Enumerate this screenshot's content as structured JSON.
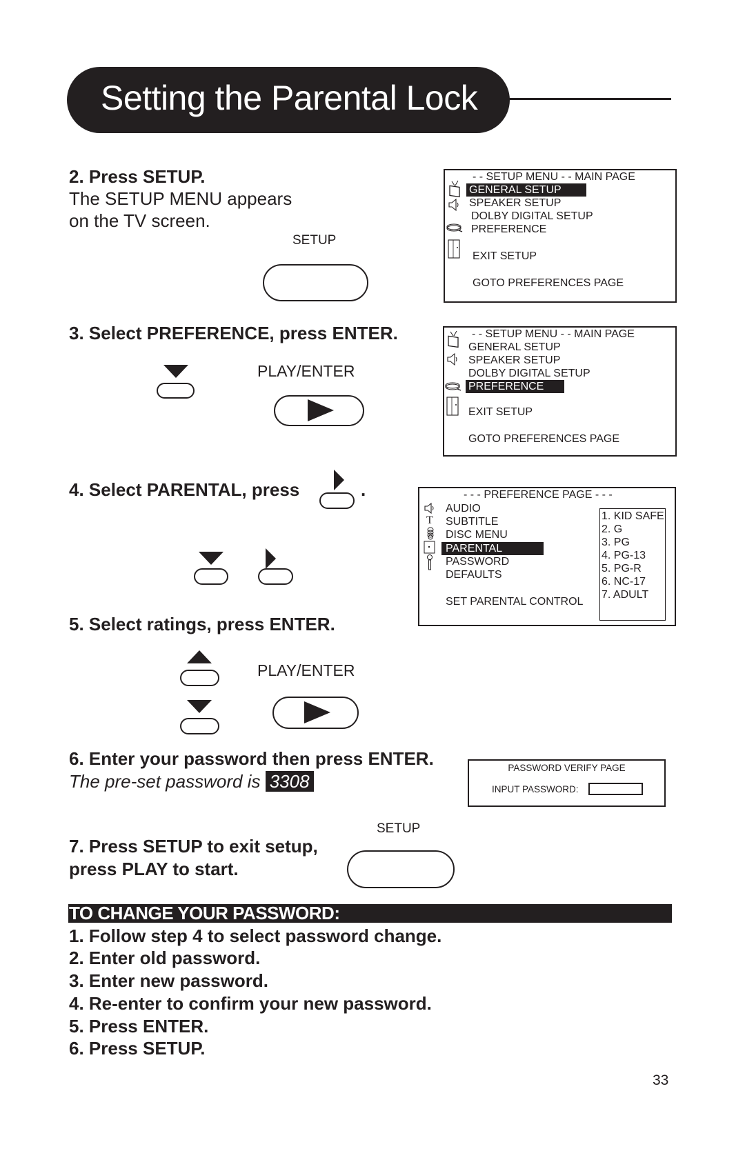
{
  "header": {
    "title": "Setting the Parental Lock"
  },
  "steps": {
    "step2": {
      "heading": "2. Press SETUP.",
      "line1": "The SETUP MENU appears",
      "line2": "on the TV screen.",
      "button_label": "SETUP"
    },
    "step3": {
      "heading": "3. Select PREFERENCE, press ENTER.",
      "play_label": "PLAY/ENTER"
    },
    "step4": {
      "heading": "4. Select PARENTAL, press",
      "heading_end": "."
    },
    "step5": {
      "heading": "5. Select ratings, press ENTER.",
      "play_label": "PLAY/ENTER"
    },
    "step6": {
      "heading": "6. Enter your password then press ENTER.",
      "note": "The pre-set password is",
      "password": "3308"
    },
    "step7": {
      "line1": "7. Press SETUP to exit setup,",
      "line2": "press PLAY to start.",
      "button_label": "SETUP"
    }
  },
  "setup_menu_1": {
    "header": "- - SETUP MENU  - -  MAIN PAGE",
    "items": [
      {
        "label": "GENERAL SETUP",
        "icon": "tv-icon",
        "selected": true
      },
      {
        "label": "SPEAKER SETUP",
        "icon": "speaker-icon",
        "selected": false
      },
      {
        "label": "DOLBY DIGITAL SETUP",
        "icon": "",
        "selected": false
      },
      {
        "label": "PREFERENCE",
        "icon": "preference-icon",
        "selected": false
      },
      {
        "label": "EXIT SETUP",
        "icon": "door-icon",
        "selected": false
      },
      {
        "label": "GOTO PREFERENCES PAGE",
        "icon": "",
        "selected": false
      }
    ]
  },
  "setup_menu_2": {
    "header": "- - SETUP MENU  - -  MAIN PAGE",
    "items": [
      {
        "label": "GENERAL SETUP",
        "icon": "tv-icon",
        "selected": false
      },
      {
        "label": "SPEAKER SETUP",
        "icon": "speaker-icon",
        "selected": false
      },
      {
        "label": "DOLBY DIGITAL SETUP",
        "icon": "",
        "selected": false
      },
      {
        "label": "PREFERENCE",
        "icon": "preference-icon",
        "selected": true
      },
      {
        "label": "EXIT SETUP",
        "icon": "door-icon",
        "selected": false
      },
      {
        "label": "GOTO PREFERENCES PAGE",
        "icon": "",
        "selected": false
      }
    ]
  },
  "preference_page": {
    "header": "- - - PREFERENCE PAGE - - -",
    "items": [
      {
        "label": "AUDIO",
        "icon": "speaker-icon",
        "selected": false
      },
      {
        "label": "SUBTITLE",
        "icon": "text-icon",
        "selected": false
      },
      {
        "label": "DISC MENU",
        "icon": "disc-icon",
        "selected": false
      },
      {
        "label": "PARENTAL",
        "icon": "safe-icon",
        "selected": true
      },
      {
        "label": "PASSWORD",
        "icon": "key-icon",
        "selected": false
      },
      {
        "label": "DEFAULTS",
        "icon": "",
        "selected": false
      }
    ],
    "footer": "SET PARENTAL CONTROL",
    "ratings": [
      "1. KID SAFE",
      "2. G",
      "3. PG",
      "4. PG-13",
      "5. PG-R",
      "6. NC-17",
      "7. ADULT"
    ]
  },
  "password_page": {
    "title": "PASSWORD VERIFY PAGE",
    "input_label": "INPUT PASSWORD:",
    "input_value": ""
  },
  "change_password": {
    "heading": "TO CHANGE YOUR PASSWORD:",
    "steps": [
      "1. Follow step 4 to select password change.",
      "2. Enter old password.",
      "3. Enter new password.",
      "4. Re-enter to confirm your new password.",
      "5. Press ENTER.",
      "6. Press SETUP."
    ]
  },
  "page_number": "33"
}
